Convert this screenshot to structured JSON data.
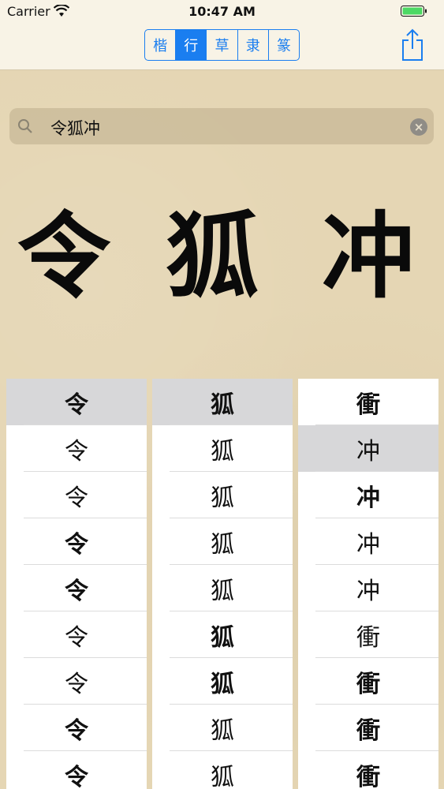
{
  "status_bar": {
    "carrier": "Carrier",
    "time": "10:47 AM"
  },
  "nav": {
    "segments": [
      {
        "label": "楷",
        "selected": false
      },
      {
        "label": "行",
        "selected": true
      },
      {
        "label": "草",
        "selected": false
      },
      {
        "label": "隶",
        "selected": false
      },
      {
        "label": "篆",
        "selected": false
      }
    ],
    "share_icon": "share-icon"
  },
  "search": {
    "value": "令狐冲",
    "clear_icon": "clear-icon",
    "search_icon": "search-icon"
  },
  "preview": {
    "chars": [
      "令",
      "狐",
      "冲"
    ]
  },
  "columns": [
    {
      "cells": [
        "令",
        "令",
        "令",
        "令",
        "令",
        "令",
        "令",
        "令",
        "令"
      ],
      "selected_index": 0
    },
    {
      "cells": [
        "狐",
        "狐",
        "狐",
        "狐",
        "狐",
        "狐",
        "狐",
        "狐",
        "狐"
      ],
      "selected_index": 0
    },
    {
      "cells": [
        "衝",
        "冲",
        "冲",
        "冲",
        "冲",
        "衝",
        "衝",
        "衝",
        "衝"
      ],
      "selected_index": 1
    }
  ],
  "colors": {
    "accent": "#1a7ef0",
    "selected_cell": "#d7d7d9",
    "paper": "#e5d6b4"
  }
}
